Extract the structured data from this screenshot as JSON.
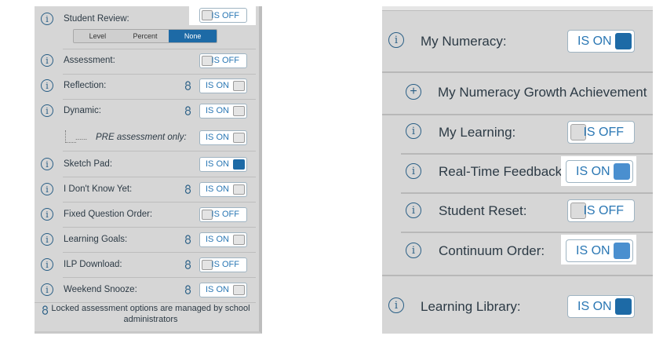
{
  "left_panel": {
    "student_review": {
      "label": "Student Review:",
      "toggle": "IS OFF"
    },
    "segment": [
      "Level",
      "Percent",
      "None"
    ],
    "segment_selected": "None",
    "rows": [
      {
        "label": "Assessment:",
        "toggle": "IS OFF",
        "state": "off",
        "locked": false
      },
      {
        "label": "Reflection:",
        "toggle": "IS ON",
        "state": "on",
        "locked": true
      },
      {
        "label": "Dynamic:",
        "toggle": "IS ON",
        "state": "on",
        "locked": true
      },
      {
        "label": "PRE assessment only:",
        "toggle": "IS ON",
        "state": "on",
        "locked": false
      },
      {
        "label": "Sketch Pad:",
        "toggle": "IS ON",
        "state": "on-active",
        "locked": false
      },
      {
        "label": "I Don't Know Yet:",
        "toggle": "IS ON",
        "state": "on",
        "locked": true
      },
      {
        "label": "Fixed Question Order:",
        "toggle": "IS OFF",
        "state": "off",
        "locked": false
      },
      {
        "label": "Learning Goals:",
        "toggle": "IS ON",
        "state": "on",
        "locked": true
      },
      {
        "label": "ILP Download:",
        "toggle": "IS OFF",
        "state": "off",
        "locked": true
      },
      {
        "label": "Weekend Snooze:",
        "toggle": "IS ON",
        "state": "on",
        "locked": true
      }
    ],
    "dotted_prefix": "......",
    "footer": "Locked assessment options are managed by school administrators",
    "info_glyph": "i"
  },
  "right_panel": {
    "my_numeracy": {
      "label": "My Numeracy:",
      "toggle": "IS ON"
    },
    "growth": {
      "label": "My Numeracy Growth Achievement"
    },
    "rows": [
      {
        "label": "My Learning:",
        "toggle": "IS OFF"
      },
      {
        "label": "Real-Time Feedback:",
        "toggle": "IS ON"
      },
      {
        "label": "Student Reset:",
        "toggle": "IS OFF"
      },
      {
        "label": "Continuum Order:",
        "toggle": "IS ON"
      }
    ],
    "learning_library": {
      "label": "Learning Library:",
      "toggle": "IS ON"
    }
  },
  "colors": {
    "accent": "#1d6aa6",
    "panel_bg": "#d6d6d6",
    "toggle_text": "#2a77b4",
    "icon": "#2a5f86"
  },
  "icons": [
    "info-icon",
    "lock-icon",
    "plus-circle-icon"
  ]
}
